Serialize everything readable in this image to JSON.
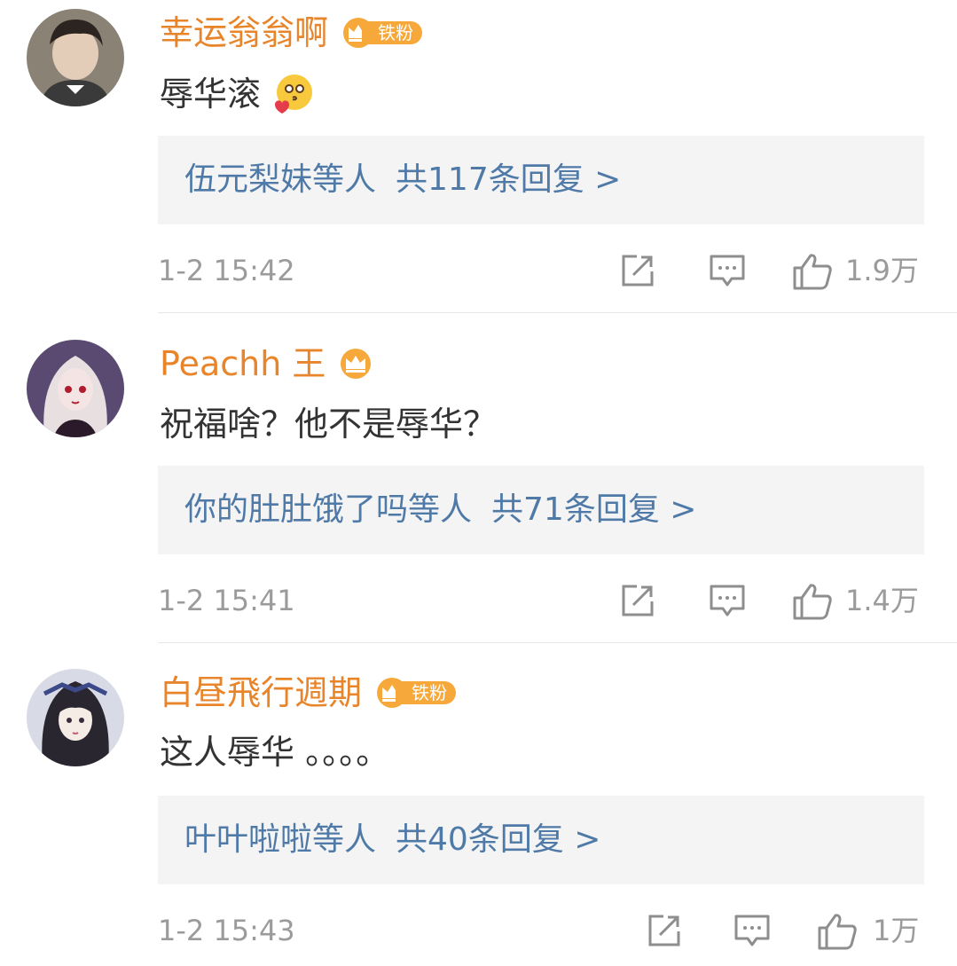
{
  "comments": [
    {
      "username": "幸运翁翁啊",
      "fan_badge": "铁粉",
      "text": "辱华滚",
      "reply_users": "伍元梨妹等人",
      "reply_count": "共117条回复 >",
      "time": "1-2 15:42",
      "likes": "1.9万"
    },
    {
      "username": "Peachh 王",
      "fan_badge": "",
      "text": "祝福啥？他不是辱华？",
      "reply_users": "你的肚肚饿了吗等人",
      "reply_count": "共71条回复 >",
      "time": "1-2 15:41",
      "likes": "1.4万"
    },
    {
      "username": "白昼飛行週期",
      "fan_badge": "铁粉",
      "text": "这人辱华 。。。。",
      "reply_users": "叶叶啦啦等人",
      "reply_count": "共40条回复 >",
      "time": "1-2 15:43",
      "likes": "1万"
    }
  ],
  "colors": {
    "username": "#e8852b",
    "reply_link": "#4f7aa8",
    "meta": "#9b9b9b",
    "reply_bg": "#f4f4f4",
    "badge": "#f6a93a"
  },
  "icons": [
    "crown-badge-icon",
    "emoji-kiss-icon",
    "share-icon",
    "comment-icon",
    "like-icon"
  ]
}
